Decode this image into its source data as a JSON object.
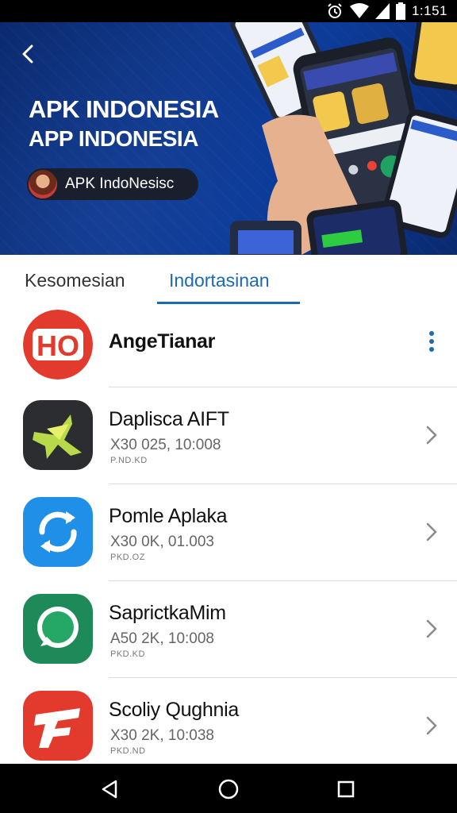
{
  "status_bar": {
    "time": "1:151",
    "icons": [
      "alarm-icon",
      "wifi-icon",
      "cellular-signal-icon",
      "battery-icon"
    ]
  },
  "banner": {
    "title": "APK INDONESIA",
    "subtitle": "APP INDONESIA",
    "channel_name": "APK IndoNesisc"
  },
  "tabs": [
    {
      "label": "Kesomesian",
      "selected": false
    },
    {
      "label": "Indortasinan",
      "selected": true
    }
  ],
  "apps": [
    {
      "name": "AngeTianar",
      "icon": "ho-logo-icon",
      "meta": "",
      "sub": ""
    },
    {
      "name": "Daplisca AIFT",
      "icon": "star-plane-icon",
      "meta": "X30 025, 10:008",
      "sub": "P.ND.KD"
    },
    {
      "name": "Pomle Aplaka",
      "icon": "sync-circle-icon",
      "meta": "X30 0K, 01.003",
      "sub": "PKD.OZ"
    },
    {
      "name": "SaprictkaMim",
      "icon": "chat-bubble-icon",
      "meta": "A50 2K, 10:008",
      "sub": "PKD.KD"
    },
    {
      "name": "Scoliy Qughnia",
      "icon": "fp-logo-icon",
      "meta": "X30 2K, 10:038",
      "sub": "PKD.ND"
    }
  ],
  "colors": {
    "accent": "#1c6ab7",
    "banner_bg": "#0f3585",
    "text_primary": "#111111",
    "text_secondary": "#666666"
  }
}
